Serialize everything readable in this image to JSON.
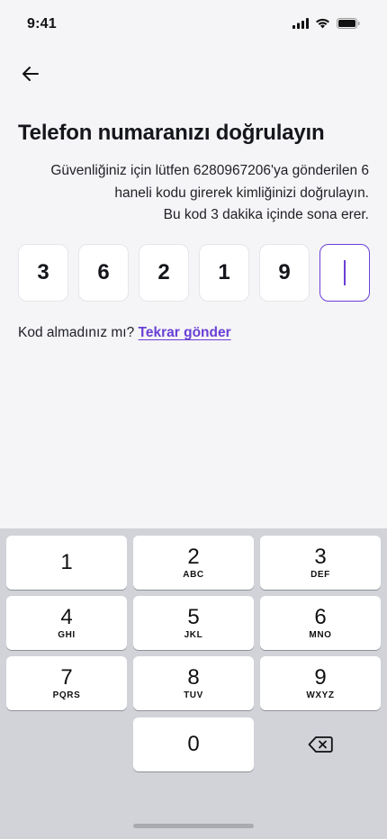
{
  "status_bar": {
    "time": "9:41"
  },
  "header": {
    "title": "Telefon numaranızı doğrulayın"
  },
  "description": {
    "lines": [
      "Güvenliğiniz için lütfen 6280967206'ya gönderilen 6",
      "haneli kodu girerek kimliğinizi doğrulayın.",
      "Bu kod 3 dakika içinde sona erer."
    ]
  },
  "otp": {
    "digits": [
      "3",
      "6",
      "2",
      "1",
      "9",
      ""
    ]
  },
  "resend": {
    "prompt": "Kod almadınız mı?",
    "link": "Tekrar gönder"
  },
  "keypad": {
    "keys": [
      {
        "num": "1",
        "letters": ""
      },
      {
        "num": "2",
        "letters": "ABC"
      },
      {
        "num": "3",
        "letters": "DEF"
      },
      {
        "num": "4",
        "letters": "GHI"
      },
      {
        "num": "5",
        "letters": "JKL"
      },
      {
        "num": "6",
        "letters": "MNO"
      },
      {
        "num": "7",
        "letters": "PQRS"
      },
      {
        "num": "8",
        "letters": "TUV"
      },
      {
        "num": "9",
        "letters": "WXYZ"
      },
      {
        "num": "0",
        "letters": ""
      }
    ]
  },
  "colors": {
    "accent": "#6a3fd6",
    "background": "#f5f5f7",
    "keyboard": "#d1d3d9"
  }
}
